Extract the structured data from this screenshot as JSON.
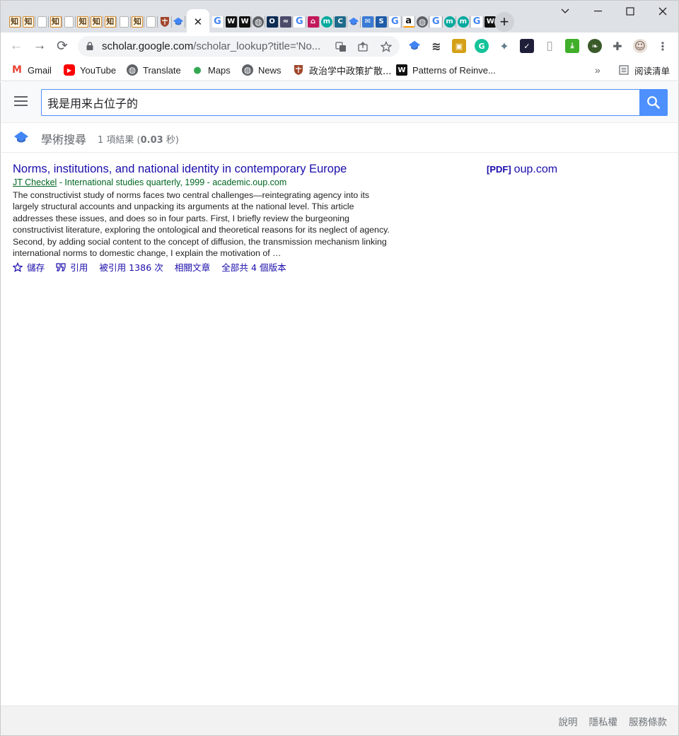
{
  "window": {
    "controls": {
      "minimize": "﹀",
      "restore": "☐",
      "close": "✕"
    }
  },
  "tabs": [
    {
      "icon": "zhi-icon",
      "glyph": "知",
      "color": "#d88a2c"
    },
    {
      "icon": "zhi-icon",
      "glyph": "知",
      "color": "#d88a2c"
    },
    {
      "icon": "doc-icon",
      "glyph": "",
      "color": "#e8e8e8"
    },
    {
      "icon": "zhi-icon",
      "glyph": "知",
      "color": "#d88a2c"
    },
    {
      "icon": "doc-icon",
      "glyph": "",
      "color": "#e8e8e8"
    },
    {
      "icon": "zhi-icon",
      "glyph": "知",
      "color": "#d88a2c"
    },
    {
      "icon": "zhi-icon",
      "glyph": "知",
      "color": "#d88a2c"
    },
    {
      "icon": "zhi-icon",
      "glyph": "知",
      "color": "#d88a2c"
    },
    {
      "icon": "doc-icon",
      "glyph": "",
      "color": "#e8e8e8"
    },
    {
      "icon": "zhi-icon",
      "glyph": "知",
      "color": "#d88a2c"
    },
    {
      "icon": "doc-icon",
      "glyph": "",
      "color": "#e8e8e8"
    },
    {
      "icon": "shield-icon",
      "glyph": "",
      "color": "#a0462b"
    },
    {
      "icon": "scholar-icon",
      "glyph": "",
      "color": "#4285f4"
    }
  ],
  "active_tab": {
    "close_glyph": "✕"
  },
  "tabs_after": [
    {
      "icon": "google-icon",
      "glyph": "G",
      "color": "#4285f4"
    },
    {
      "icon": "w-icon",
      "glyph": "W",
      "color": "#111111"
    },
    {
      "icon": "w-icon",
      "glyph": "W",
      "color": "#111111"
    },
    {
      "icon": "globe-icon",
      "glyph": "◍",
      "color": "#5f6368"
    },
    {
      "icon": "o-icon",
      "glyph": "O",
      "color": "#0d2c54"
    },
    {
      "icon": "tag-icon",
      "glyph": "≈",
      "color": "#4a4a6a"
    },
    {
      "icon": "google-icon",
      "glyph": "G",
      "color": "#4285f4"
    },
    {
      "icon": "home-icon",
      "glyph": "⌂",
      "color": "#c2185b"
    },
    {
      "icon": "m-icon",
      "glyph": "m",
      "color": "#00a99d"
    },
    {
      "icon": "c-icon",
      "glyph": "C",
      "color": "#1f6a8a"
    },
    {
      "icon": "scholar-icon",
      "glyph": "",
      "color": "#4285f4"
    },
    {
      "icon": "mail-icon",
      "glyph": "✉",
      "color": "#3a7bd5"
    },
    {
      "icon": "s-icon",
      "glyph": "S",
      "color": "#1e5ba8"
    },
    {
      "icon": "google-icon",
      "glyph": "G",
      "color": "#4285f4"
    },
    {
      "icon": "amazon-icon",
      "glyph": "a",
      "color": "#111111"
    },
    {
      "icon": "globe-icon",
      "glyph": "◍",
      "color": "#5f6368"
    },
    {
      "icon": "google-icon",
      "glyph": "G",
      "color": "#4285f4"
    },
    {
      "icon": "m-icon",
      "glyph": "m",
      "color": "#00a99d"
    },
    {
      "icon": "m-icon",
      "glyph": "m",
      "color": "#00a99d"
    },
    {
      "icon": "google-icon",
      "glyph": "G",
      "color": "#4285f4"
    },
    {
      "icon": "w-icon",
      "glyph": "W",
      "color": "#111111"
    }
  ],
  "new_tab": "+",
  "toolbar": {
    "back": "←",
    "forward": "→",
    "reload": "⟳",
    "url_host": "scholar.google.com",
    "url_path": "/scholar_lookup?title='No..."
  },
  "extensions": [
    {
      "icon": "scholar-ext-icon",
      "glyph": "",
      "color": "#4285f4"
    },
    {
      "icon": "zotero-ext-icon",
      "glyph": "≋",
      "color": "#333333"
    },
    {
      "icon": "image-ext-icon",
      "glyph": "▣",
      "color": "#d4a017"
    },
    {
      "icon": "grammarly-icon",
      "glyph": "G",
      "color": "#15c39a"
    },
    {
      "icon": "satellite-ext-icon",
      "glyph": "✦",
      "color": "#607d8b"
    },
    {
      "icon": "check-ext-icon",
      "glyph": "✓",
      "color": "#1f1f3a"
    },
    {
      "icon": "page-ext-icon",
      "glyph": "▯",
      "color": "#bdbdbd"
    },
    {
      "icon": "download-ext-icon",
      "glyph": "⤓",
      "color": "#3fae29"
    },
    {
      "icon": "leaf-ext-icon",
      "glyph": "❧",
      "color": "#3a5a2a"
    },
    {
      "icon": "puzzle-icon",
      "glyph": "✚",
      "color": "#5f6368"
    },
    {
      "icon": "avatar-icon",
      "glyph": "☺",
      "color": "#6d4c41"
    },
    {
      "icon": "kebab-menu-icon",
      "glyph": "⋮",
      "color": "#5f6368"
    }
  ],
  "bookmarks": [
    {
      "label": "Gmail",
      "icon": "gmail-icon",
      "glyph": "M",
      "color": "#ea4335"
    },
    {
      "label": "YouTube",
      "icon": "youtube-icon",
      "glyph": "▶",
      "color": "#ff0000"
    },
    {
      "label": "Translate",
      "icon": "globe-icon",
      "glyph": "◍",
      "color": "#5f6368"
    },
    {
      "label": "Maps",
      "icon": "maps-pin-icon",
      "glyph": "●",
      "color": "#34a853"
    },
    {
      "label": "News",
      "icon": "globe-icon",
      "glyph": "◍",
      "color": "#5f6368"
    },
    {
      "label": "政治学中政策扩散...",
      "icon": "shield-icon",
      "glyph": "",
      "color": "#a0462b"
    },
    {
      "label": "Patterns of Reinve...",
      "icon": "w-icon",
      "glyph": "W",
      "color": "#111111"
    }
  ],
  "bookmarks_overflow": "»",
  "reading_list": "阅读清单",
  "search": {
    "query": "我是用来占位子的",
    "button_label": "Search"
  },
  "scholar": {
    "title": "學術搜尋",
    "count_prefix": "1 項結果 (",
    "count_time": "0.03",
    "count_suffix": " 秒)"
  },
  "result": {
    "title": "Norms, institutions, and national identity in contemporary Europe",
    "author": "JT Checkel",
    "meta_rest": " - International studies quarterly, 1999 - academic.oup.com",
    "snippet": "The constructivist study of norms faces two central challenges—reintegrating agency into its largely structural accounts and unpacking its arguments at the national level. This article addresses these issues, and does so in four parts. First, I briefly review the burgeoning constructivist literature, exploring the ontological and theoretical reasons for its neglect of agency. Second, by adding social content to the concept of diffusion, the transmission mechanism linking international norms to domestic change, I explain the motivation of …",
    "save": "儲存",
    "cite": "引用",
    "cited_by": "被引用 1386 次",
    "related": "相關文章",
    "versions": "全部共 4 個版本",
    "side_tag": "[PDF]",
    "side_domain": "oup.com"
  },
  "footer": {
    "help": "說明",
    "privacy": "隱私權",
    "terms": "服務條款"
  }
}
